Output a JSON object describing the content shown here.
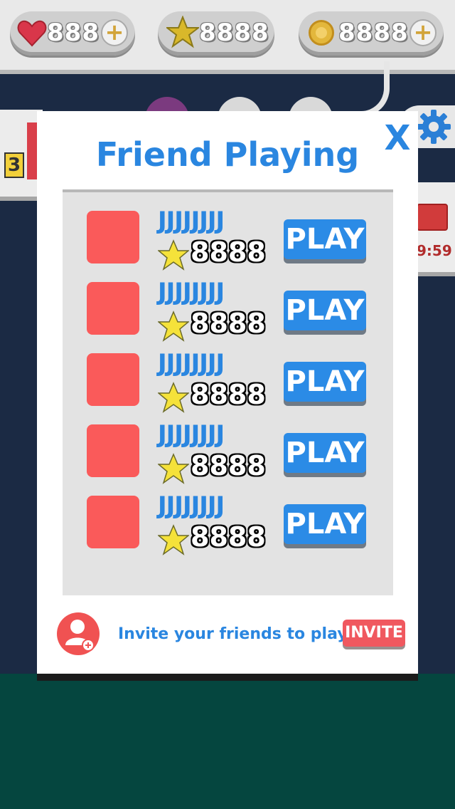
{
  "hud": {
    "lives": "888",
    "stars": "8888",
    "coins": "8888",
    "plus_symbol": "+"
  },
  "background": {
    "level_number": "3",
    "timer": "9:59"
  },
  "modal": {
    "title": "Friend Playing",
    "close_label": "X",
    "friends": [
      {
        "name": "JJJJJJJJ",
        "score": "8888",
        "play_label": "PLAY"
      },
      {
        "name": "JJJJJJJJ",
        "score": "8888",
        "play_label": "PLAY"
      },
      {
        "name": "JJJJJJJJ",
        "score": "8888",
        "play_label": "PLAY"
      },
      {
        "name": "JJJJJJJJ",
        "score": "8888",
        "play_label": "PLAY"
      },
      {
        "name": "JJJJJJJJ",
        "score": "8888",
        "play_label": "PLAY"
      }
    ],
    "invite_text": "Invite your friends to play!",
    "invite_button": "INVITE"
  },
  "colors": {
    "accent_blue": "#2a86e0",
    "avatar_red": "#fa5a5a",
    "invite_red": "#f0585f",
    "star_yellow": "#f5e23a"
  }
}
